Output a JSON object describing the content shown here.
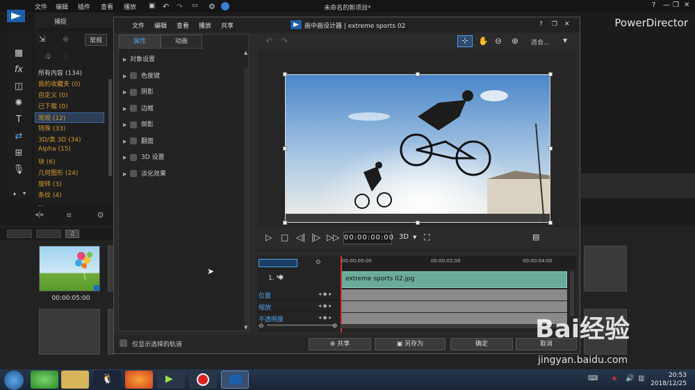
{
  "app": {
    "title": "未命名的新项目*",
    "brand": "PowerDirector",
    "menu": [
      "文件",
      "编辑",
      "插件",
      "查看",
      "播放"
    ],
    "left_tab": "捕捉",
    "window_controls": [
      "?",
      "—",
      "❐",
      "✕"
    ]
  },
  "library": {
    "view_label": "常规",
    "categories": [
      {
        "label": "所有内容 (134)",
        "state": "first"
      },
      {
        "label": "我的收藏夹 (0)",
        "state": "normal"
      },
      {
        "label": "自定义 (0)",
        "state": "normal"
      },
      {
        "label": "已下载 (0)",
        "state": "normal"
      },
      {
        "label": "常规 (12)",
        "state": "sel"
      },
      {
        "label": "特殊 (33)",
        "state": "normal"
      },
      {
        "label": "3D/类 3D (34)",
        "state": "normal"
      },
      {
        "label": "Alpha (15)",
        "state": "normal"
      },
      {
        "label": "块 (6)",
        "state": "normal"
      },
      {
        "label": "几何图形 (24)",
        "state": "normal"
      },
      {
        "label": "旋转 (3)",
        "state": "normal"
      },
      {
        "label": "条纹 (4)",
        "state": "normal"
      },
      {
        "label": "...",
        "state": "normal"
      }
    ],
    "thumb_time": "00:00:05:00"
  },
  "dialog": {
    "menu": [
      "文件",
      "编辑",
      "查看",
      "播放",
      "共享"
    ],
    "title": "画中画设计器 | extreme sports 02",
    "controls": [
      "?",
      "❐",
      "✕"
    ],
    "tabs": [
      "属性",
      "动画"
    ],
    "properties": [
      "对象设置",
      "色度键",
      "阴影",
      "边框",
      "倒影",
      "翻面",
      "3D 设置",
      "淡化效果"
    ],
    "zoom_label": "适合...",
    "timecode": "00:00:00:00",
    "mode_3d": "3D",
    "ruler_ticks": [
      "00:00:00:00",
      "00:00:02:00",
      "00:00:04:00"
    ],
    "track_label": "1. *",
    "clip_name": "extreme sports 02.jpg",
    "keyframe_rows": [
      "位置",
      "缩放",
      "不透明度"
    ],
    "only_selected_label": "仅显示选择的轨道",
    "buttons": {
      "share": "共享",
      "save_as": "另存为",
      "ok": "确定",
      "cancel": "取消"
    }
  },
  "taskbar": {
    "time": "20:53",
    "date": "2018/12/25"
  },
  "watermark": {
    "text": "Bai经验",
    "url": "jingyan.baidu.com"
  },
  "colors": {
    "accent_blue": "#4fa3e8",
    "category_orange": "#d59a2a",
    "clip_teal": "#6bab9a"
  }
}
